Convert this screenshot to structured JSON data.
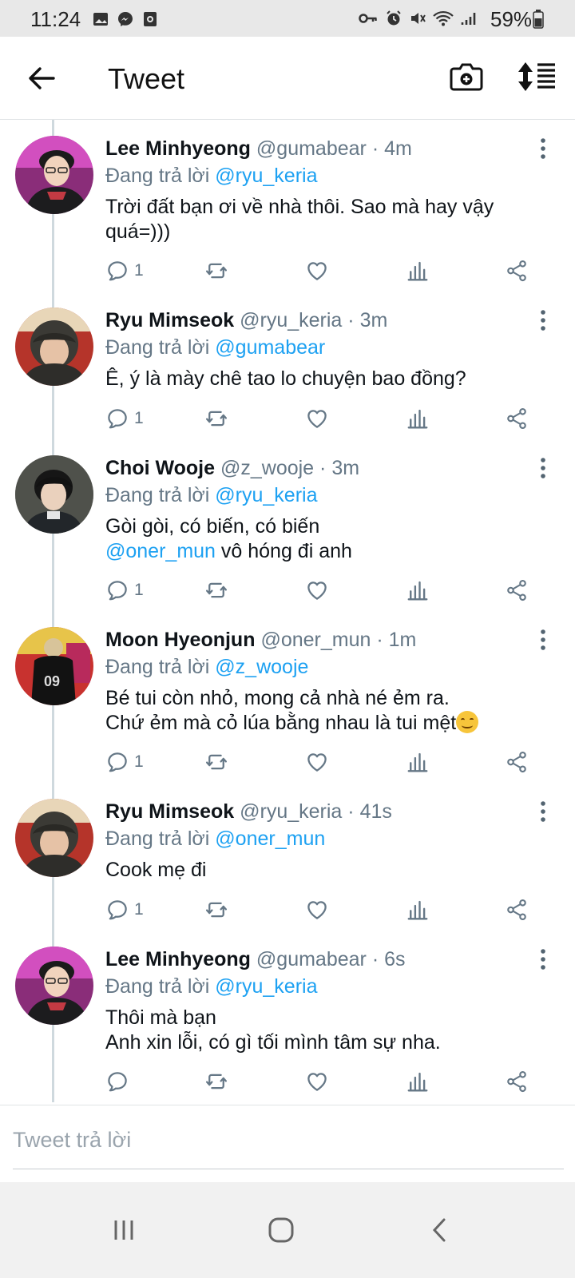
{
  "status_bar": {
    "time": "11:24",
    "battery": "59%"
  },
  "header": {
    "title": "Tweet"
  },
  "reply_prefix": "Đang trả lời",
  "tweets": [
    {
      "name": "Lee Minhyeong",
      "handle": "@gumabear",
      "separator": "·",
      "time": "4m",
      "reply_to": "@ryu_keria",
      "text": "Trời đất bạn ơi về nhà thôi. Sao mà hay vậy quá=)))",
      "reply_count": "1"
    },
    {
      "name": "Ryu Mimseok",
      "handle": "@ryu_keria",
      "separator": "·",
      "time": "3m",
      "reply_to": "@gumabear",
      "text": "Ê, ý là mày chê tao lo chuyện bao đồng?",
      "reply_count": "1"
    },
    {
      "name": "Choi Wooje",
      "handle": "@z_wooje",
      "separator": "·",
      "time": "3m",
      "reply_to": "@ryu_keria",
      "text_line1": "Gòi gòi, có biến, có biến",
      "text_mention": "@oner_mun",
      "text_line2_rest": " vô hóng đi anh",
      "reply_count": "1"
    },
    {
      "name": "Moon Hyeonjun",
      "handle": "@oner_mun",
      "separator": "·",
      "time": "1m",
      "reply_to": "@z_wooje",
      "text_line1": "Bé tui còn nhỏ, mong cả nhà né ẻm ra.",
      "text_line2": "Chứ ẻm mà cỏ lúa bằng nhau là tui mệt",
      "reply_count": "1"
    },
    {
      "name": "Ryu Mimseok",
      "handle": "@ryu_keria",
      "separator": "·",
      "time": "41s",
      "reply_to": "@oner_mun",
      "text": "Cook mẹ đi",
      "reply_count": "1"
    },
    {
      "name": "Lee Minhyeong",
      "handle": "@gumabear",
      "separator": "·",
      "time": "6s",
      "reply_to": "@ryu_keria",
      "text_line1": "Thôi mà bạn",
      "text_line2": "Anh xin lỗi, có gì tối mình tâm sự nha.",
      "reply_count": ""
    }
  ],
  "composer": {
    "placeholder": "Tweet trả lời"
  },
  "icons": {
    "status_left": [
      "image-icon",
      "messenger-icon",
      "screen-record-icon"
    ],
    "status_right": [
      "key-icon",
      "alarm-icon",
      "mute-icon",
      "wifi-icon",
      "signal-icon",
      "battery-icon"
    ],
    "header": [
      "back-arrow-icon",
      "camera-plus-icon",
      "sort-icon"
    ],
    "tweet_actions": [
      "reply-icon",
      "retweet-icon",
      "like-icon",
      "stats-icon",
      "share-icon"
    ],
    "nav": [
      "recent-apps-icon",
      "home-icon",
      "back-icon"
    ]
  },
  "colors": {
    "link": "#1da1f2",
    "secondary_text": "#657786",
    "status_bar_bg": "#e8e8e8",
    "nav_bar_bg": "#f1f1f1"
  }
}
